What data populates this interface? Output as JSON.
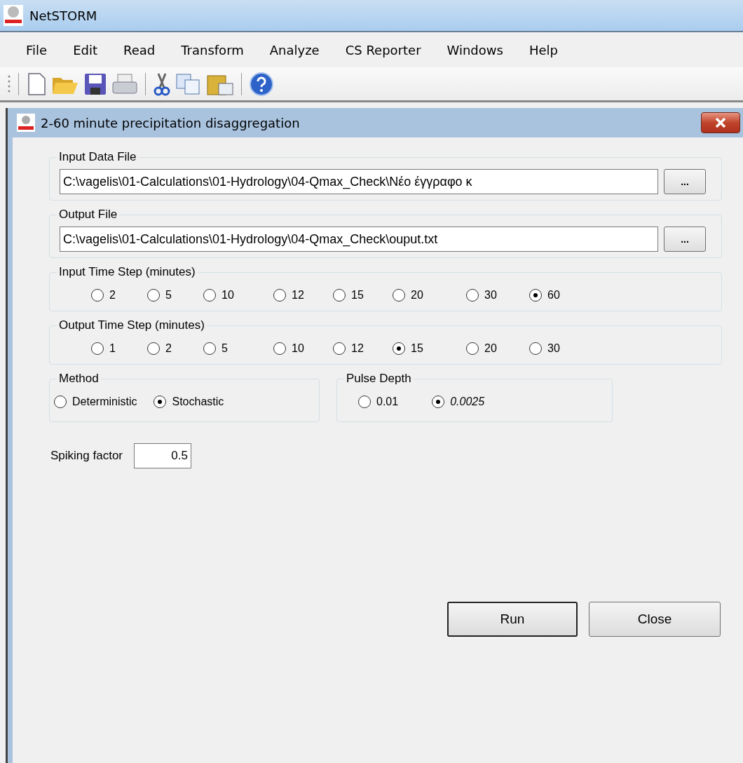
{
  "app": {
    "title": "NetSTORM"
  },
  "menu": [
    "File",
    "Edit",
    "Read",
    "Transform",
    "Analyze",
    "CS Reporter",
    "Windows",
    "Help"
  ],
  "dialog": {
    "title": "2-60 minute precipitation disaggregation",
    "input_file": {
      "label": "Input Data File",
      "value": "C:\\vagelis\\01-Calculations\\01-Hydrology\\04-Qmax_Check\\Νέο έγγραφο κ",
      "browse": "..."
    },
    "output_file": {
      "label": "Output File",
      "value": "C:\\vagelis\\01-Calculations\\01-Hydrology\\04-Qmax_Check\\ouput.txt",
      "browse": "..."
    },
    "input_step": {
      "label": "Input Time Step (minutes)",
      "options": [
        {
          "label": "2",
          "selected": false
        },
        {
          "label": "5",
          "selected": false
        },
        {
          "label": "10",
          "selected": false
        },
        {
          "label": "12",
          "selected": false
        },
        {
          "label": "15",
          "selected": false
        },
        {
          "label": "20",
          "selected": false
        },
        {
          "label": "30",
          "selected": false
        },
        {
          "label": "60",
          "selected": true
        }
      ]
    },
    "output_step": {
      "label": "Output Time Step (minutes)",
      "options": [
        {
          "label": "1",
          "selected": false
        },
        {
          "label": "2",
          "selected": false
        },
        {
          "label": "5",
          "selected": false
        },
        {
          "label": "10",
          "selected": false
        },
        {
          "label": "12",
          "selected": false
        },
        {
          "label": "15",
          "selected": true
        },
        {
          "label": "20",
          "selected": false
        },
        {
          "label": "30",
          "selected": false
        }
      ]
    },
    "method": {
      "label": "Method",
      "options": [
        {
          "label": "Deterministic",
          "selected": false
        },
        {
          "label": "Stochastic",
          "selected": true
        }
      ]
    },
    "pulse_depth": {
      "label": "Pulse Depth",
      "options": [
        {
          "label": "0.01",
          "selected": false,
          "italic": false
        },
        {
          "label": "0.0025",
          "selected": true,
          "italic": true
        }
      ]
    },
    "spiking": {
      "label": "Spiking factor",
      "value": "0.5"
    },
    "buttons": [
      "Run",
      "Close"
    ]
  }
}
